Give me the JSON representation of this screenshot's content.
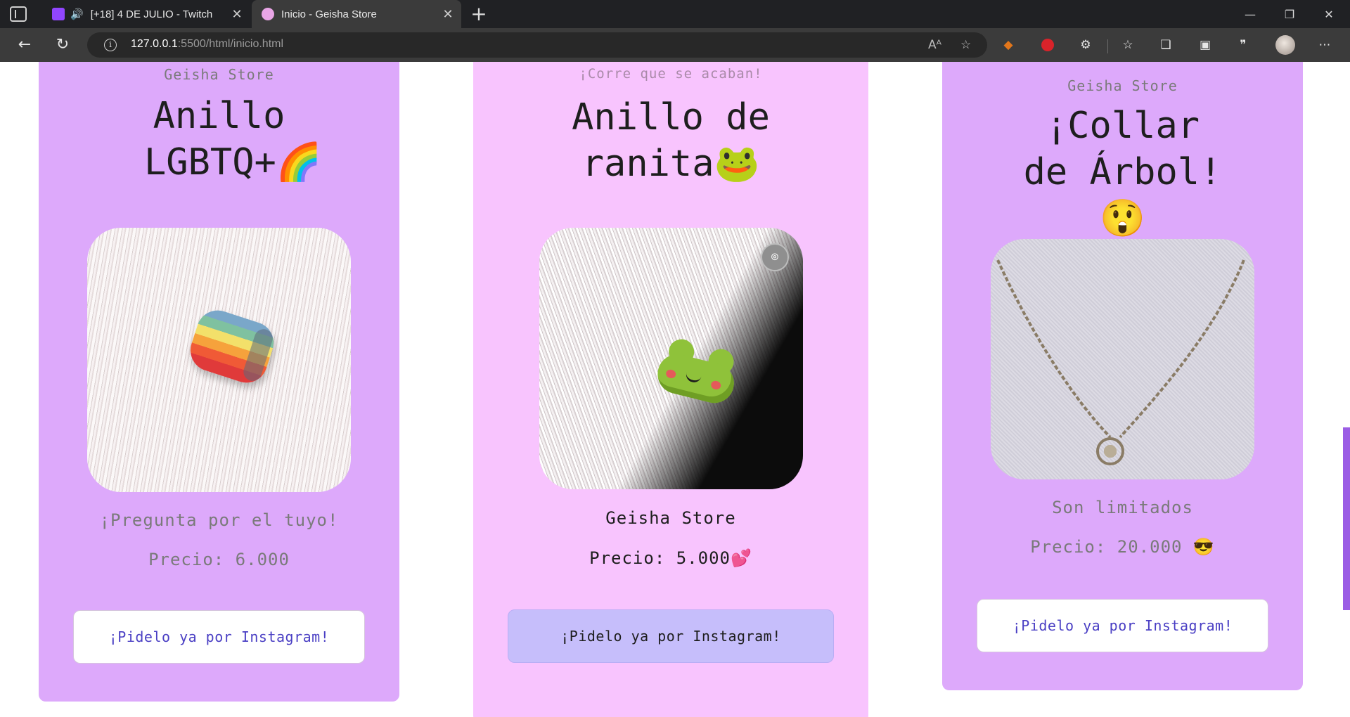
{
  "browser": {
    "tabs": [
      {
        "title": "[+18] 4 DE JULIO - Twitch",
        "favicon": "twitch-icon",
        "audio": true
      },
      {
        "title": "Inicio - Geisha Store",
        "favicon": "geisha-store-icon",
        "active": true
      }
    ],
    "url_host": "127.0.0.1",
    "url_rest": ":5500/html/inicio.html"
  },
  "products": [
    {
      "top_label": "Geisha Store",
      "title": "Anillo LGBTQ+🌈",
      "subline": "¡Pregunta por el tuyo!",
      "price": "Precio: 6.000",
      "cta": "¡Pidelo ya por Instagram!"
    },
    {
      "top_label": "¡Corre que se acaban!",
      "title": "Anillo de ranita🐸",
      "subline": "Geisha Store",
      "price": "Precio: 5.000💕",
      "cta": "¡Pidelo ya por Instagram!"
    },
    {
      "top_label": "Geisha Store",
      "title": "¡Collar de Árbol!😲",
      "subline": "Son limitados",
      "price": "Precio: 20.000 😎",
      "cta": "¡Pidelo ya por Instagram!"
    }
  ],
  "colors": {
    "card_lilac": "#dda9fb",
    "card_pink": "#f8c4fe",
    "cta_text": "#4a3fc4",
    "cta_hover": "#c6befb",
    "scroll_accent": "#9b5de5"
  }
}
